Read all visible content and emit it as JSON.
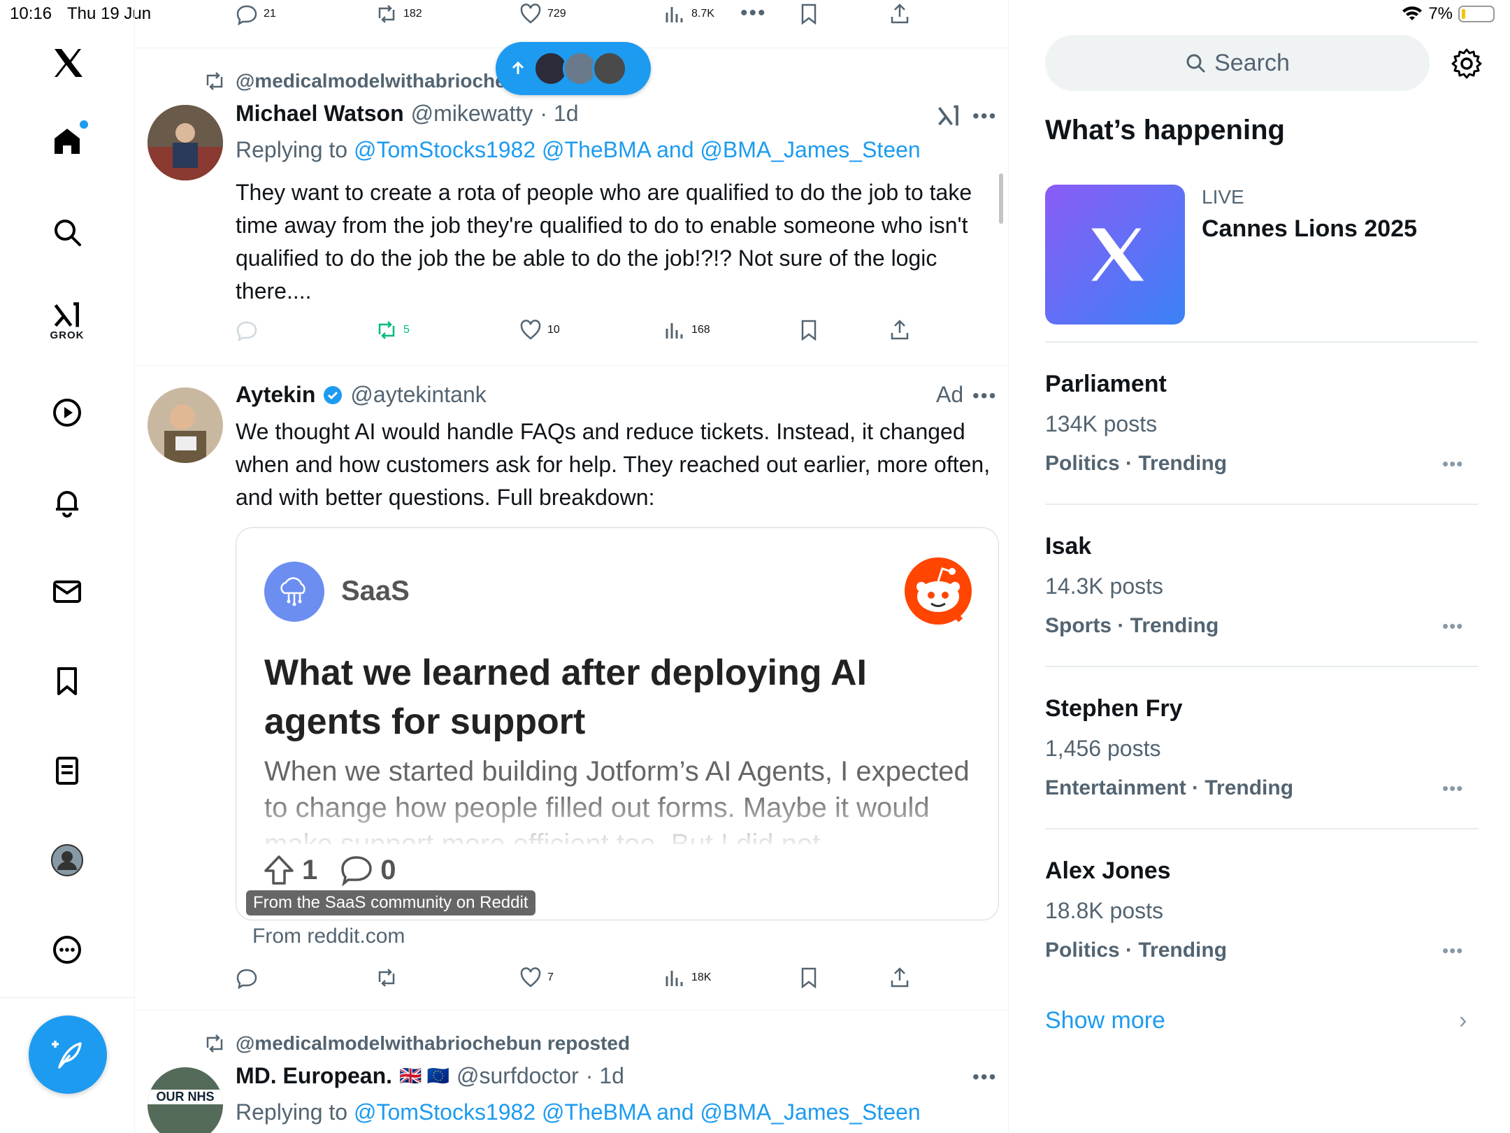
{
  "status_bar": {
    "time": "10:16",
    "date": "Thu 19 Jun",
    "battery": "7%"
  },
  "nav": {
    "grok_label": "GROK"
  },
  "top_actions": {
    "replies": "21",
    "reposts": "182",
    "likes": "729",
    "views": "8.7K"
  },
  "tweet1": {
    "repost_by": "@medicalmodelwithabriochebun reposted",
    "name": "Michael Watson",
    "handle": "@mikewatty",
    "time": "· 1d",
    "reply_prefix": "Replying to",
    "reply_to": "@TomStocks1982 @TheBMA and @BMA_James_Steen",
    "text": "They want to create a rota of people who are qualified to do the job to take time away from the job they're qualified to do to enable someone who isn't qualified to do the job the be able to do the job!?!? Not sure of the logic there....",
    "replies": "",
    "reposts": "5",
    "likes": "10",
    "views": "168"
  },
  "tweet2": {
    "name": "Aytekin",
    "handle": "@aytekintank",
    "ad_label": "Ad",
    "text": "We thought AI would handle FAQs and reduce tickets. Instead, it changed when and how customers ask for help. They reached out earlier, more often, and with better questions. Full breakdown:",
    "card": {
      "subreddit": "SaaS",
      "title": "What we learned after deploying AI agents for support",
      "description": "When we started building Jotform’s AI Agents, I expected to change how people filled out forms. Maybe it would make support more efficient too. But I did not",
      "upvotes": "1",
      "comments": "0",
      "caption": "From the SaaS community on Reddit"
    },
    "from": "From reddit.com",
    "replies": "",
    "reposts": "",
    "likes": "7",
    "views": "18K"
  },
  "tweet3": {
    "repost_by": "@medicalmodelwithabriochebun reposted",
    "name": "MD. European.",
    "flags": "🇬🇧 🇪🇺",
    "handle": "@surfdoctor",
    "time": "· 1d",
    "reply_prefix": "Replying to",
    "reply_to": "@TomStocks1982 @TheBMA and @BMA_James_Steen",
    "avatar_text": "OUR NHS"
  },
  "right": {
    "search_placeholder": "Search",
    "heading": "What’s happening",
    "live": {
      "label": "LIVE",
      "title": "Cannes Lions 2025"
    },
    "trends": [
      {
        "name": "Parliament",
        "count": "134K posts",
        "category": "Politics · Trending"
      },
      {
        "name": "Isak",
        "count": "14.3K posts",
        "category": "Sports · Trending"
      },
      {
        "name": "Stephen Fry",
        "count": "1,456 posts",
        "category": "Entertainment · Trending"
      },
      {
        "name": "Alex Jones",
        "count": "18.8K posts",
        "category": "Politics · Trending"
      }
    ],
    "show_more": "Show more"
  },
  "colors": {
    "accent": "#1d9bf0",
    "repost_green": "#00ba7c",
    "secondary_text": "#536471"
  }
}
